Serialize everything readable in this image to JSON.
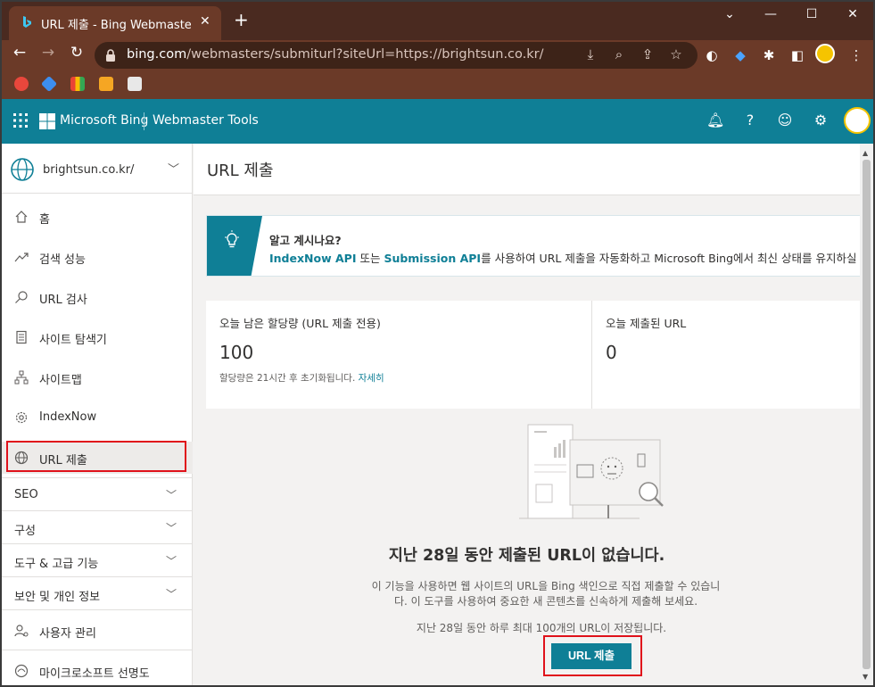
{
  "browser": {
    "tab_title": "URL 제출 - Bing Webmaster Tools",
    "tab_close": "✕",
    "new_tab": "+",
    "win_controls": [
      "⌄",
      "—",
      "☐",
      "✕"
    ],
    "url_host": "bing.com",
    "url_path": "/webmasters/submiturl?siteUrl=https://brightsun.co.kr/"
  },
  "header": {
    "brand": "Microsoft Bing",
    "product": "Webmaster Tools",
    "icons": [
      "bell-icon",
      "help-icon",
      "feedback-smile-icon",
      "settings-gear-icon"
    ]
  },
  "sidebar": {
    "site": "brightsun.co.kr/",
    "items": [
      {
        "label": "홈",
        "icon": "home-icon"
      },
      {
        "label": "검색 성능",
        "icon": "trend-icon"
      },
      {
        "label": "URL 검사",
        "icon": "search-icon"
      },
      {
        "label": "사이트 탐색기",
        "icon": "document-icon"
      },
      {
        "label": "사이트맵",
        "icon": "sitemap-icon"
      },
      {
        "label": "IndexNow",
        "icon": "gear-icon"
      },
      {
        "label": "URL 제출",
        "icon": "globe-icon"
      }
    ],
    "groups": [
      "SEO",
      "구성",
      "도구 & 고급 기능",
      "보안 및 개인 정보"
    ],
    "bottom_items": [
      {
        "label": "사용자 관리",
        "icon": "user-manage-icon"
      },
      {
        "label": "마이크로소프트 선명도",
        "icon": "clarity-icon"
      }
    ]
  },
  "main": {
    "title": "URL 제출",
    "tip_title": "알고 계시나요?",
    "tip_link1": "IndexNow API",
    "tip_mid": " 또는 ",
    "tip_link2": "Submission API",
    "tip_rest": "를 사용하여 URL 제출을 자동화하고 Microsoft Bing에서 최신 상태를 유지하실 수 있",
    "quota_label": "오늘 남은 할당량 (URL 제출 전용)",
    "quota_value": "100",
    "quota_note": "할당량은 21시간 후 초기화됩니다. ",
    "quota_link": "자세히",
    "submitted_label": "오늘 제출된 URL",
    "submitted_value": "0",
    "empty_title": "지난 28일 동안 제출된 URL이 없습니다.",
    "empty_desc": "이 기능을 사용하면 웹 사이트의 URL을 Bing 색인으로 직접 제출할 수 있습니다. 이 도구를 사용하여 중요한 새 콘텐츠를 신속하게 제출해 보세요.",
    "empty_note": "지난 28일 동안 하루 최대 100개의 URL이 저장됩니다.",
    "submit_label": "URL 제출"
  },
  "colors": {
    "accent": "#0f7f96",
    "highlight": "#e0121b",
    "chrome": "#6b3a28"
  }
}
